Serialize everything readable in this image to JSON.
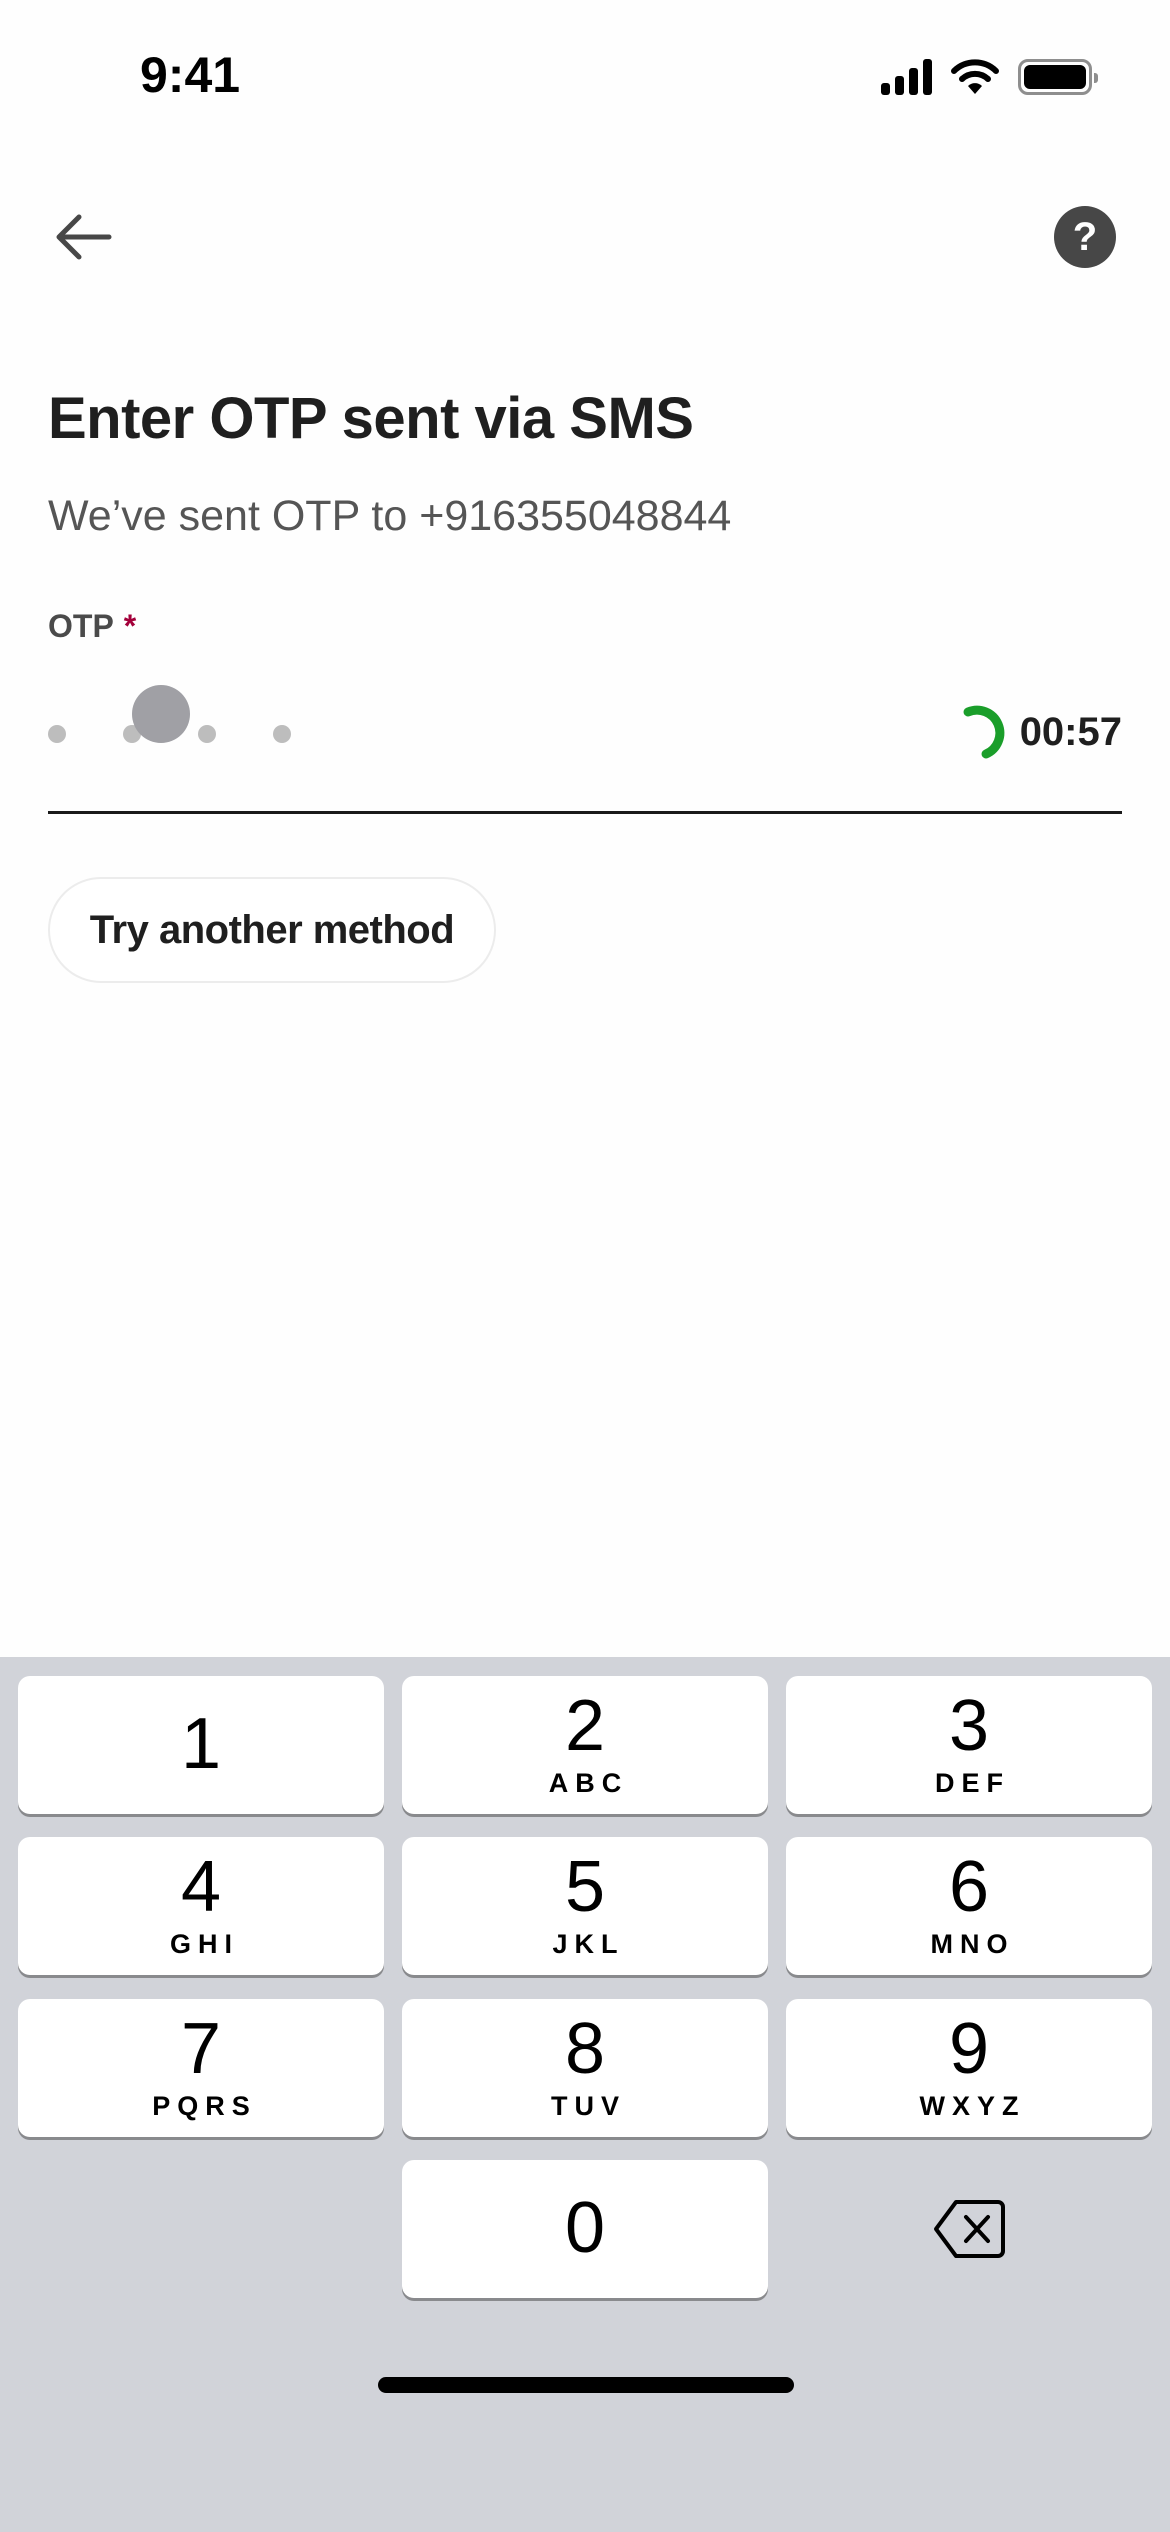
{
  "status_bar": {
    "time": "9:41",
    "icons": [
      "cellular-signal-icon",
      "wifi-icon",
      "battery-icon"
    ]
  },
  "header": {
    "back_icon": "arrow-left-icon",
    "help_icon": "question-mark-icon",
    "help_glyph": "?"
  },
  "main": {
    "title": "Enter OTP sent via SMS",
    "subtitle": "We’ve sent OTP to +916355048844",
    "otp_field": {
      "label": "OTP",
      "required_marker": "*",
      "value": "",
      "digit_count": 6,
      "timer": "00:57",
      "timer_color": "#1a9e2a"
    },
    "alt_method_button": "Try another method"
  },
  "keyboard": {
    "keys": [
      {
        "digit": "1",
        "letters": ""
      },
      {
        "digit": "2",
        "letters": "ABC"
      },
      {
        "digit": "3",
        "letters": "DEF"
      },
      {
        "digit": "4",
        "letters": "GHI"
      },
      {
        "digit": "5",
        "letters": "JKL"
      },
      {
        "digit": "6",
        "letters": "MNO"
      },
      {
        "digit": "7",
        "letters": "PQRS"
      },
      {
        "digit": "8",
        "letters": "TUV"
      },
      {
        "digit": "9",
        "letters": "WXYZ"
      },
      {
        "digit": "0",
        "letters": ""
      }
    ],
    "delete_icon": "backspace-icon"
  },
  "colors": {
    "accent_required": "#a3003a",
    "keyboard_bg": "#d1d3d9",
    "help_bg": "#474747"
  }
}
